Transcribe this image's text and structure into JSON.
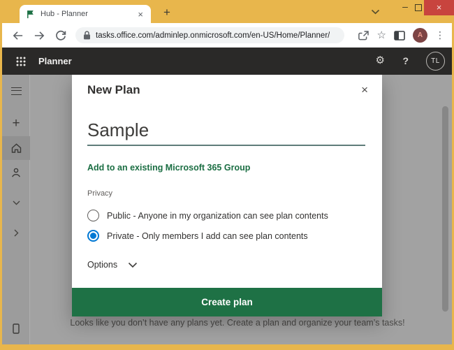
{
  "colors": {
    "frame_yellow": "#e8b64c",
    "close_red": "#c8443e",
    "header_dark": "#2a2928",
    "planner_green": "#1e7145",
    "link_green": "#1b6e43",
    "radio_blue": "#0078d4",
    "overlay_gray": "#a2a2a2"
  },
  "titlebar": {
    "tab_title": "Hub - Planner",
    "tab_close_glyph": "×",
    "new_tab_glyph": "+",
    "minimize_glyph": "–",
    "close_glyph": "×"
  },
  "toolbar": {
    "url": "tasks.office.com/adminlep.onmicrosoft.com/en-US/Home/Planner/",
    "star_glyph": "☆",
    "menu_glyph": "⋮",
    "avatar_letter": "A"
  },
  "app_header": {
    "title": "Planner",
    "gear_glyph": "⚙",
    "help_glyph": "?",
    "avatar_initials": "TL"
  },
  "modal": {
    "title": "New Plan",
    "close_glyph": "×",
    "plan_name_value": "Sample",
    "group_link_label": "Add to an existing Microsoft 365 Group",
    "privacy_label": "Privacy",
    "privacy_options": [
      {
        "label": "Public - Anyone in my organization can see plan contents",
        "selected": false
      },
      {
        "label": "Private - Only members I add can see plan contents",
        "selected": true
      }
    ],
    "options_label": "Options",
    "create_button_label": "Create plan"
  },
  "main": {
    "empty_state_text": "Looks like you don’t have any plans yet. Create a plan and organize your team’s tasks!"
  }
}
